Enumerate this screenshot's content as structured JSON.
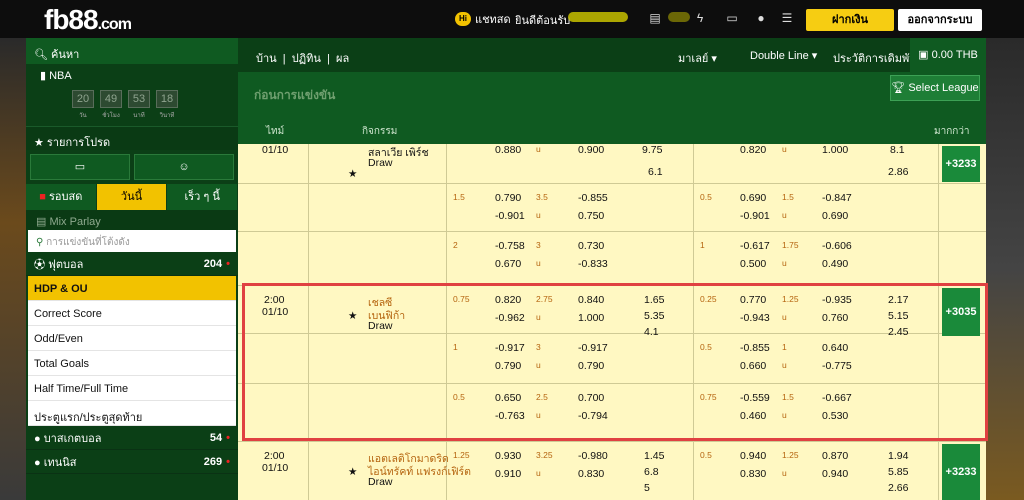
{
  "topbar": {
    "logo": "fb88",
    "logo_domain": ".com",
    "chat_label": "แชทสด",
    "welcome": "ยินดีต้อนรับ",
    "deposit": "ฝากเงิน",
    "logout": "ออกจากระบบ"
  },
  "sidebar": {
    "search": "ค้นหา",
    "nba": "NBA",
    "timers": [
      {
        "v": "20",
        "l": "วัน"
      },
      {
        "v": "49",
        "l": "ชั่วโมง"
      },
      {
        "v": "53",
        "l": "นาที"
      },
      {
        "v": "18",
        "l": "วินาที"
      }
    ],
    "favorites": "รายการโปรด",
    "tabs": [
      "รอบสด",
      "วันนี้",
      "เร็ว ๆ นี้"
    ],
    "mix": "Mix Parlay",
    "filter_placeholder": "การแข่งขันที่โต้งดัง",
    "football": {
      "label": "ฟุตบอล",
      "count": "204"
    },
    "menu": [
      "HDP & OU",
      "Correct Score",
      "Odd/Even",
      "Total Goals",
      "Half Time/Full Time",
      "ประตูแรก/ประตูสุดท้าย"
    ],
    "basketball": {
      "label": "บาสเกตบอล",
      "count": "54"
    },
    "tennis": {
      "label": "เทนนิส",
      "count": "269"
    }
  },
  "main": {
    "breadcrumb": [
      "บ้าน",
      "ปฏิทิน",
      "ผล"
    ],
    "odds_format": "มาเลย์",
    "line_mode": "Double Line",
    "history": "ประวัติการเดิมพัน",
    "balance": "0.00 THB",
    "league_title": "ก่อนการแข่งขัน",
    "select_league": "Select League",
    "col_time": "ไทม์",
    "col_event": "กิจกรรม",
    "col_more": "มากกว่า",
    "rows": [
      {
        "time": "",
        "date": "01/10",
        "teams": [
          "สลาเวีย เพิร์ช",
          "Draw"
        ],
        "a": [
          "0.880",
          "0.900",
          "9.75",
          "6.1"
        ],
        "b": [
          "0.820",
          "1.000",
          "8.1",
          "2.86"
        ],
        "hdpA": "",
        "ouA": "u",
        "hdpB": "",
        "ouB": "u",
        "more": "+3233"
      },
      {
        "hdp1": "1.5",
        "ou1": "3.5",
        "o1": [
          "0.790",
          "-0.901",
          "-0.855",
          "0.750"
        ],
        "hdp2": "0.5",
        "ou2": "1.5",
        "o2": [
          "0.690",
          "-0.901",
          "-0.847",
          "0.690"
        ]
      },
      {
        "hdp1": "2",
        "ou1": "3",
        "o1": [
          "-0.758",
          "0.670",
          "0.730",
          "-0.833"
        ],
        "hdp2": "1",
        "ou2": "1.75",
        "o2": [
          "-0.617",
          "0.500",
          "-0.606",
          "0.490"
        ]
      },
      {
        "time": "2:00",
        "date": "01/10",
        "teams": [
          "เชลซี",
          "เบนฟิก้า",
          "Draw"
        ],
        "hdp1": "0.75",
        "ou1": "2.75",
        "o1": [
          "0.820",
          "-0.962",
          "0.840",
          "1.000"
        ],
        "x12": [
          "1.65",
          "5.35",
          "4.1"
        ],
        "hdp2": "0.25",
        "ou2": "1.25",
        "o2": [
          "0.770",
          "-0.943",
          "-0.935",
          "0.760"
        ],
        "x12b": [
          "2.17",
          "5.15",
          "2.45"
        ],
        "more": "+3035"
      },
      {
        "hdp1": "1",
        "ou1": "3",
        "o1": [
          "-0.917",
          "0.790",
          "-0.917",
          "0.790"
        ],
        "hdp2": "0.5",
        "ou2": "1",
        "o2": [
          "-0.855",
          "0.660",
          "0.640",
          "-0.775"
        ]
      },
      {
        "hdp1": "0.5",
        "ou1": "2.5",
        "o1": [
          "0.650",
          "-0.763",
          "0.700",
          "-0.794"
        ],
        "hdp2": "0.75",
        "ou2": "1.5",
        "o2": [
          "-0.559",
          "0.460",
          "-0.667",
          "0.530"
        ]
      },
      {
        "time": "2:00",
        "date": "01/10",
        "teams": [
          "แอตเลติโกมาดริด",
          "ไอน์ทรัคท์ แฟรงก์เฟิร์ต",
          "Draw"
        ],
        "hdp1": "1.25",
        "ou1": "3.25",
        "o1": [
          "0.930",
          "0.910",
          "-0.980",
          "0.830"
        ],
        "x12": [
          "1.45",
          "6.8",
          "5"
        ],
        "hdp2": "0.5",
        "ou2": "1.25",
        "o2": [
          "0.940",
          "0.830",
          "0.870",
          "0.940"
        ],
        "x12b": [
          "1.94",
          "5.85",
          "2.66"
        ],
        "more": "+3233"
      }
    ]
  },
  "colors": {
    "dark_green": "#0b3f16",
    "accent_yellow": "#f2c200",
    "odds_bg": "#fff8c2",
    "highlight": "#e04141"
  }
}
